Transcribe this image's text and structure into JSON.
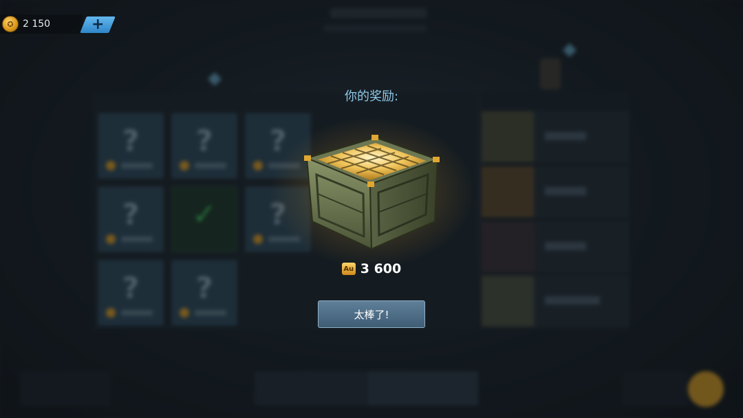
{
  "currency": {
    "icon": "gold-medal-icon",
    "value": "2 150",
    "add_icon": "plus-icon"
  },
  "reward": {
    "title": "你的奖励:",
    "item_icon": "ammo-crate-gold-bars",
    "amount_icon_label": "Au",
    "amount": "3 600",
    "confirm_label": "太棒了!"
  },
  "colors": {
    "accent_blue": "#63b7ef",
    "title_blue": "#8fc7e8",
    "gold": "#d89618",
    "button": "#4f6e87"
  }
}
